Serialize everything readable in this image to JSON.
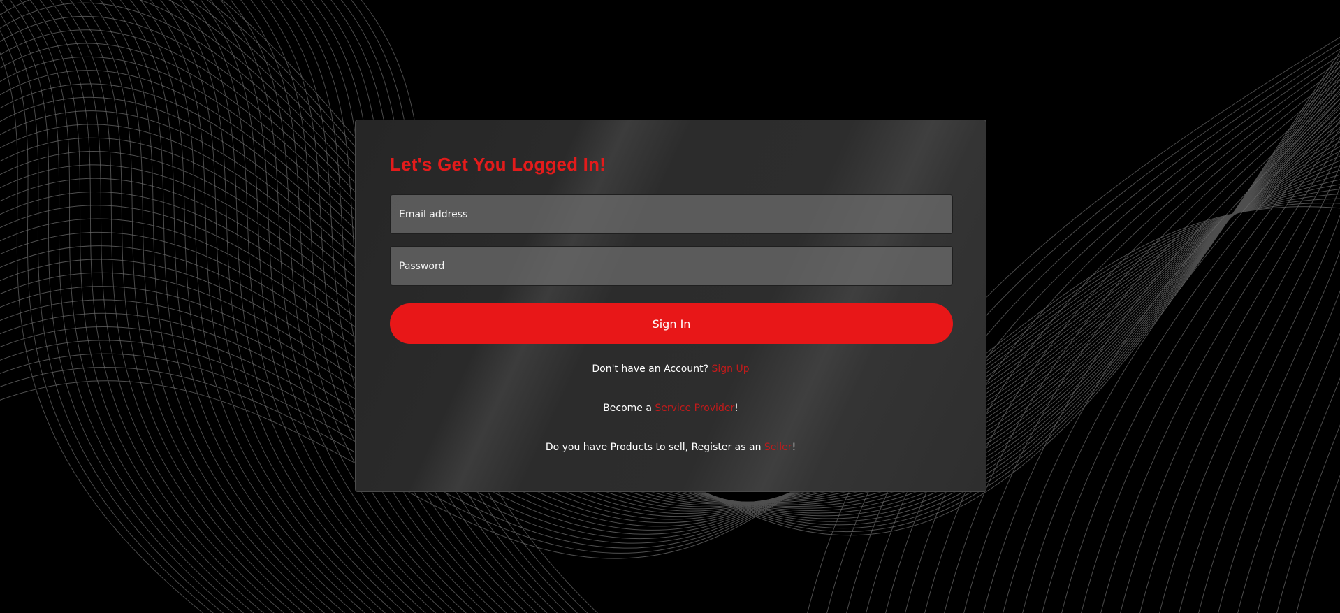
{
  "theme": {
    "accent": "#e81718",
    "title_color": "#e31b1b",
    "link_color": "#c21b1b",
    "background": "#000000",
    "card_background": "#2c2c2c"
  },
  "login": {
    "title": "Let's Get You Logged In!",
    "email_placeholder": "Email address",
    "password_placeholder": "Password",
    "signin_label": "Sign In",
    "signup_prompt": "Don't have an Account? ",
    "signup_link": "Sign Up",
    "provider_prefix": "Become a ",
    "provider_link": "Service Provider",
    "provider_suffix": "!",
    "seller_prefix": "Do you have Products to sell, Register as an ",
    "seller_link": "Seller",
    "seller_suffix": "!"
  }
}
